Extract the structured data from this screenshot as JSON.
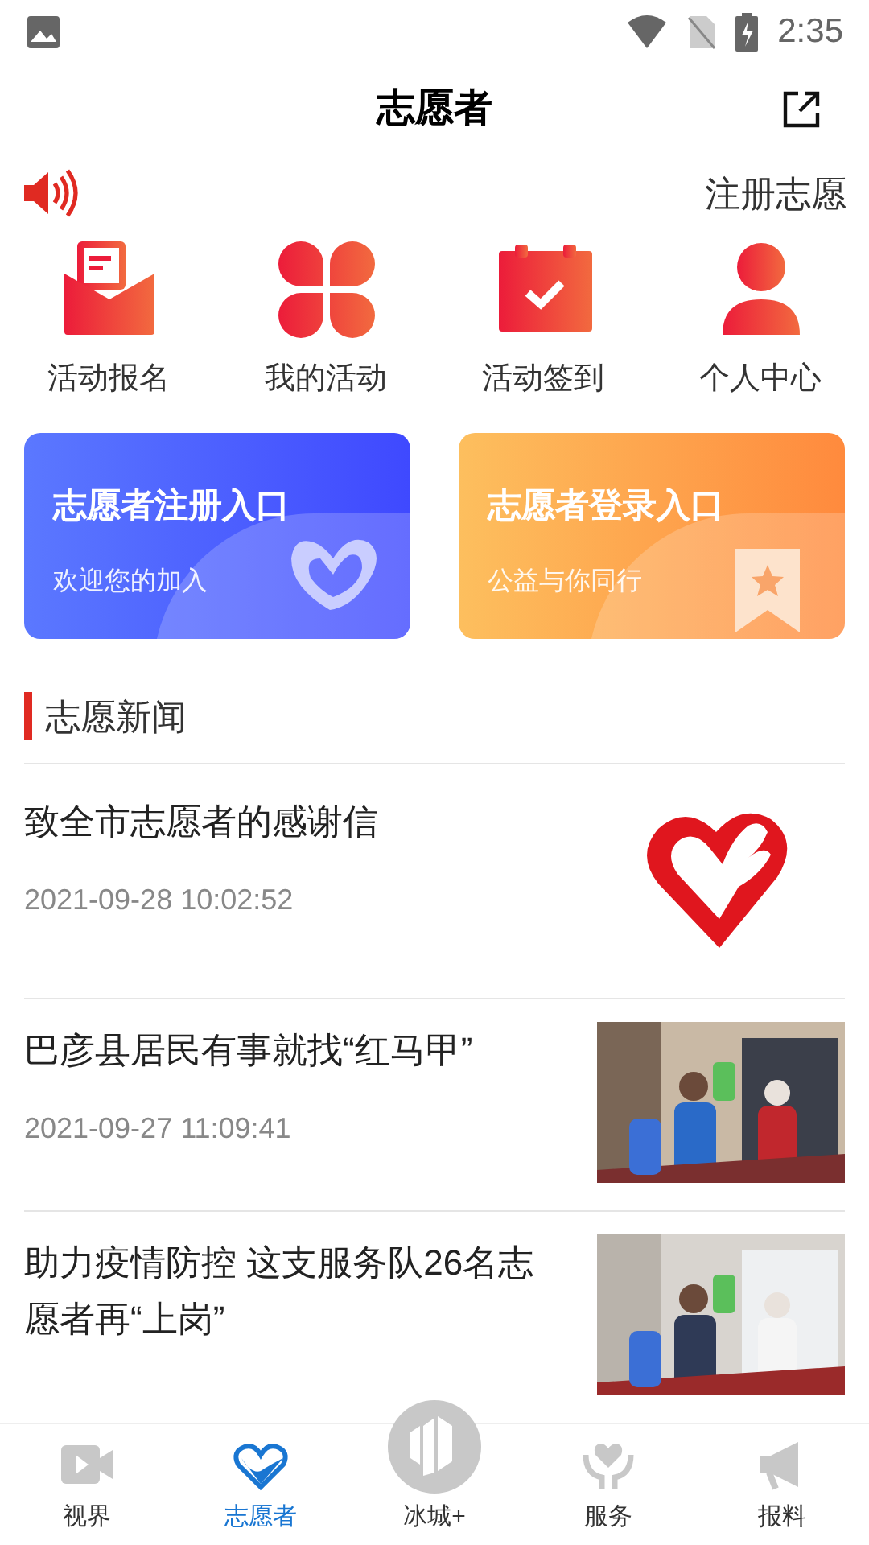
{
  "status_bar": {
    "time": "2:35"
  },
  "header": {
    "title": "志愿者"
  },
  "notice": {
    "text": "注册志愿"
  },
  "shortcuts": [
    {
      "kind": "signup",
      "label": "活动报名"
    },
    {
      "kind": "activities",
      "label": "我的活动"
    },
    {
      "kind": "checkin",
      "label": "活动签到"
    },
    {
      "kind": "profile",
      "label": "个人中心"
    }
  ],
  "entry_cards": [
    {
      "kind": "register",
      "title": "志愿者注册入口",
      "subtitle": "欢迎您的加入"
    },
    {
      "kind": "login",
      "title": "志愿者登录入口",
      "subtitle": "公益与你同行"
    }
  ],
  "news": {
    "heading": "志愿新闻",
    "items": [
      {
        "title": "致全市志愿者的感谢信",
        "date": "2021-09-28 10:02:52",
        "kind": "logo"
      },
      {
        "title": "巴彦县居民有事就找“红马甲”",
        "date": "2021-09-27 11:09:41",
        "kind": "picture"
      },
      {
        "title": "助力疫情防控 这支服务队26名志愿者再“上岗”",
        "kind": "picture"
      }
    ]
  },
  "bottom_nav": [
    {
      "kind": "video",
      "label": "视界",
      "selected": false
    },
    {
      "kind": "heart",
      "label": "志愿者",
      "selected": true
    },
    {
      "kind": "city",
      "label": "冰城+",
      "selected": false
    },
    {
      "kind": "service",
      "label": "服务",
      "selected": false
    },
    {
      "kind": "report",
      "label": "报料",
      "selected": false
    }
  ]
}
